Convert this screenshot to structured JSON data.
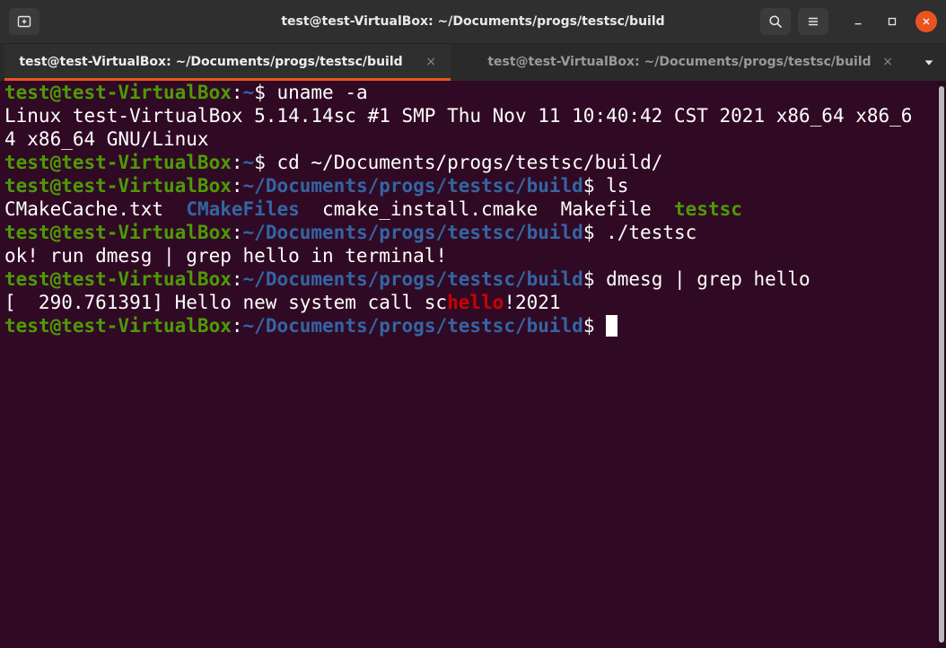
{
  "window": {
    "title": "test@test-VirtualBox: ~/Documents/progs/testsc/build"
  },
  "tabs": [
    {
      "label": "test@test-VirtualBox: ~/Documents/progs/testsc/build",
      "active": true,
      "close": "×"
    },
    {
      "label": "test@test-VirtualBox: ~/Documents/progs/testsc/build",
      "active": false,
      "close": "×"
    }
  ],
  "icons": {
    "new_tab": "new-tab-icon",
    "search": "search-icon",
    "menu": "hamburger-menu-icon",
    "minimize": "minimize-icon",
    "maximize": "maximize-icon",
    "close": "close-icon",
    "tab_list": "chevron-down-icon"
  },
  "colors": {
    "background": "#300a24",
    "prompt_user": "#4e9a06",
    "prompt_path": "#3465a4",
    "highlight": "#cc0000",
    "accent": "#e95420"
  },
  "terminal": {
    "user": "test@test-VirtualBox",
    "colon": ":",
    "home": "~",
    "build_path": "~/Documents/progs/testsc/build",
    "dollar": "$",
    "cmd_uname": " uname -a",
    "out_uname_1": "Linux test-VirtualBox 5.14.14sc #1 SMP Thu Nov 11 10:40:42 CST 2021 x86_64 x86_6",
    "out_uname_2": "4 x86_64 GNU/Linux",
    "cmd_cd": " cd ~/Documents/progs/testsc/build/",
    "cmd_ls": " ls",
    "ls_cmakecache": "CMakeCache.txt",
    "ls_cmakefiles": "CMakeFiles",
    "ls_cmake_install": "cmake_install.cmake",
    "ls_makefile": "Makefile",
    "ls_testsc": "testsc",
    "cmd_run": " ./testsc",
    "out_run": "ok! run dmesg | grep hello in terminal!",
    "cmd_dmesg": " dmesg | grep hello",
    "dmesg_prefix": "[  290.761391] Hello new system call sc",
    "dmesg_match": "hello",
    "dmesg_suffix": "!2021"
  }
}
